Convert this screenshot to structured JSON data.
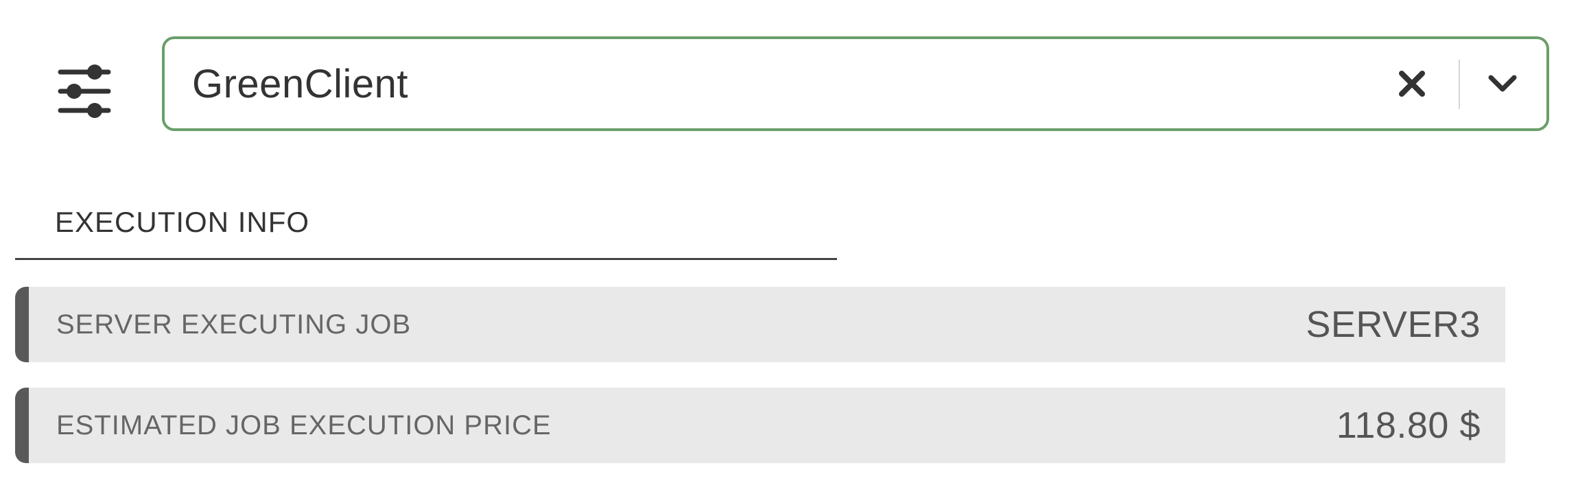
{
  "toolbar": {
    "filter_icon": "sliders-icon"
  },
  "client_select": {
    "value": "GreenClient",
    "clear_icon": "close-icon",
    "dropdown_icon": "chevron-down-icon",
    "border_color": "#6a9e6a"
  },
  "execution_info": {
    "title": "EXECUTION INFO",
    "rows": [
      {
        "label": "SERVER EXECUTING JOB",
        "value": "SERVER3"
      },
      {
        "label": "ESTIMATED JOB EXECUTION PRICE",
        "value": "118.80 $"
      }
    ]
  }
}
